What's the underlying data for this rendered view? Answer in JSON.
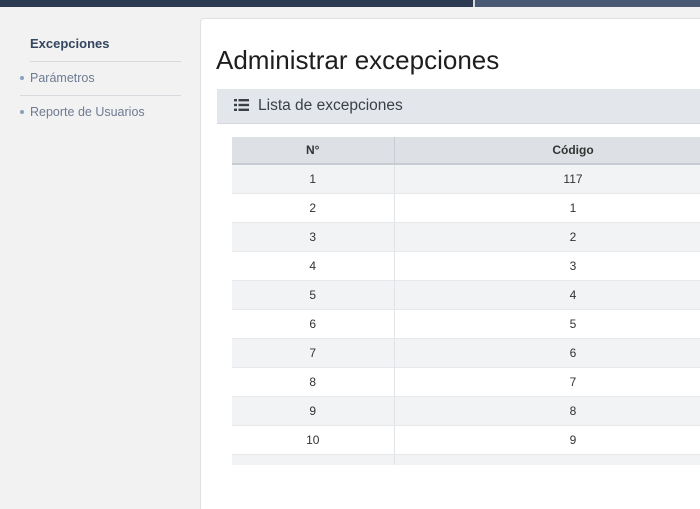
{
  "sidebar": {
    "items": [
      {
        "label": "Excepciones",
        "active": true
      },
      {
        "label": "Parámetros",
        "active": false
      },
      {
        "label": "Reporte de Usuarios",
        "active": false
      }
    ]
  },
  "main": {
    "title": "Administrar excepciones",
    "panel": {
      "icon": "list-icon",
      "title": "Lista de excepciones"
    },
    "table": {
      "columns": [
        "N°",
        "Código"
      ],
      "rows": [
        [
          "1",
          "117"
        ],
        [
          "2",
          "1"
        ],
        [
          "3",
          "2"
        ],
        [
          "4",
          "3"
        ],
        [
          "5",
          "4"
        ],
        [
          "6",
          "5"
        ],
        [
          "7",
          "6"
        ],
        [
          "8",
          "7"
        ],
        [
          "9",
          "8"
        ],
        [
          "10",
          "9"
        ]
      ]
    }
  },
  "colors": {
    "accent": "#2c3a52",
    "header_bg": "#e3e6ea",
    "nav_text": "#6d7b93"
  }
}
